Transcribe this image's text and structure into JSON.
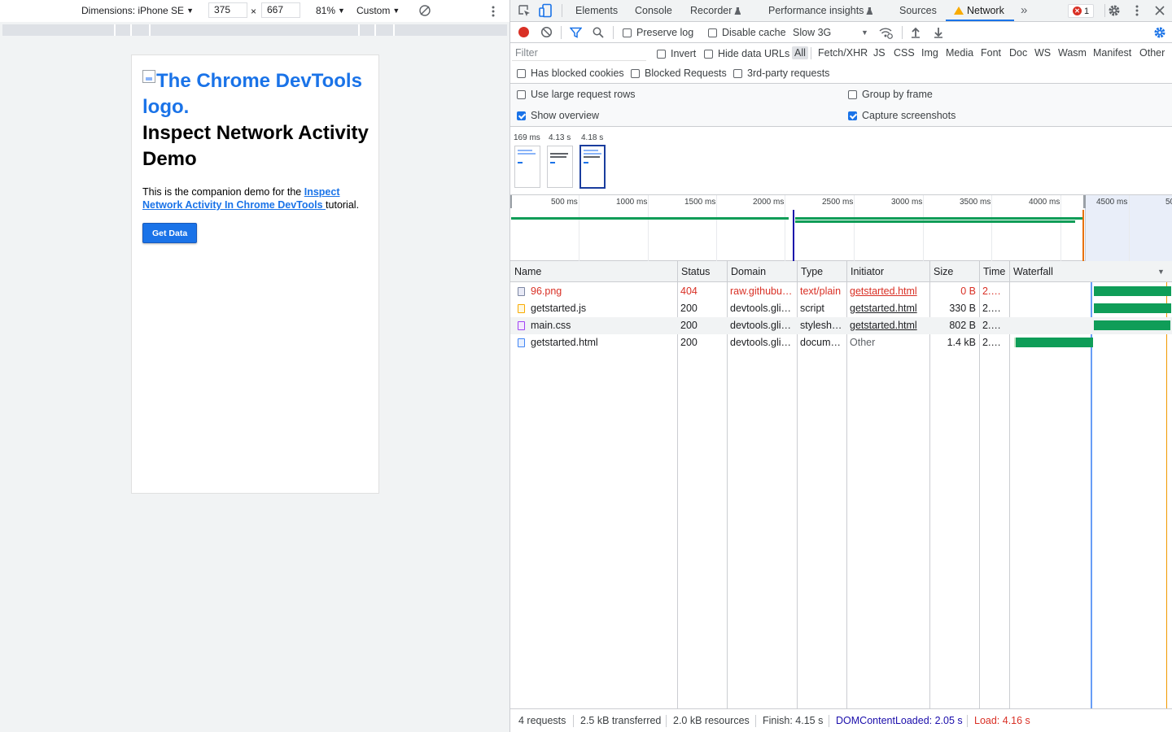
{
  "device_toolbar": {
    "dimensions_label": "Dimensions: iPhone SE",
    "width": "375",
    "times": "×",
    "height": "667",
    "zoom": "81%",
    "throttle": "Custom"
  },
  "page": {
    "logo_alt": "The Chrome DevTools logo.",
    "heading": "Inspect Network Activity Demo",
    "intro_before": "This is the companion demo for the ",
    "intro_link": "Inspect Network Activity In Chrome DevTools ",
    "intro_after": "tutorial.",
    "button": "Get Data"
  },
  "devtools": {
    "tabs": [
      "Elements",
      "Console",
      "Recorder",
      "Performance insights",
      "Sources",
      "Network"
    ],
    "active_tab": "Network",
    "more_tabs": "»",
    "error_count": "1",
    "toolbar": {
      "preserve_log": "Preserve log",
      "disable_cache": "Disable cache",
      "throttling": "Slow 3G"
    },
    "filter": {
      "placeholder": "Filter",
      "invert": "Invert",
      "hide_data_urls": "Hide data URLs",
      "types": [
        "All",
        "Fetch/XHR",
        "JS",
        "CSS",
        "Img",
        "Media",
        "Font",
        "Doc",
        "WS",
        "Wasm",
        "Manifest",
        "Other"
      ],
      "selected_type": "All",
      "has_blocked_cookies": "Has blocked cookies",
      "blocked_requests": "Blocked Requests",
      "third_party": "3rd-party requests"
    },
    "settings": {
      "large_rows": "Use large request rows",
      "group_by_frame": "Group by frame",
      "show_overview": "Show overview",
      "capture_screenshots": "Capture screenshots"
    },
    "screenshots": [
      {
        "time": "169 ms"
      },
      {
        "time": "4.13 s"
      },
      {
        "time": "4.18 s"
      }
    ],
    "timeline_ticks": [
      "500 ms",
      "1000 ms",
      "1500 ms",
      "2000 ms",
      "2500 ms",
      "3000 ms",
      "3500 ms",
      "4000 ms",
      "4500 ms",
      "50"
    ],
    "columns": [
      "Name",
      "Status",
      "Domain",
      "Type",
      "Initiator",
      "Size",
      "Time",
      "Waterfall"
    ],
    "requests": [
      {
        "name": "96.png",
        "status": "404",
        "domain": "raw.githubu…",
        "type": "text/plain",
        "initiator": "getstarted.html",
        "size": "0 B",
        "time": "2.…",
        "icon": "image-file-icon"
      },
      {
        "name": "getstarted.js",
        "status": "200",
        "domain": "devtools.gli…",
        "type": "script",
        "initiator": "getstarted.html",
        "size": "330 B",
        "time": "2.…",
        "icon": "script-file-icon"
      },
      {
        "name": "main.css",
        "status": "200",
        "domain": "devtools.gli…",
        "type": "stylesh…",
        "initiator": "getstarted.html",
        "size": "802 B",
        "time": "2.…",
        "icon": "stylesheet-file-icon"
      },
      {
        "name": "getstarted.html",
        "status": "200",
        "domain": "devtools.gli…",
        "type": "docum…",
        "initiator": "Other",
        "size": "1.4 kB",
        "time": "2.…",
        "icon": "document-file-icon"
      }
    ],
    "status": {
      "requests": "4 requests",
      "transferred": "2.5 kB transferred",
      "resources": "2.0 kB resources",
      "finish": "Finish: 4.15 s",
      "dom_content_loaded": "DOMContentLoaded: 2.05 s",
      "load": "Load: 4.16 s"
    },
    "colors": {
      "accent": "#1a73e8",
      "error": "#d93025",
      "dcl": "#1a0dab",
      "load": "#d93025",
      "waterfall": "#0f9d58"
    }
  }
}
